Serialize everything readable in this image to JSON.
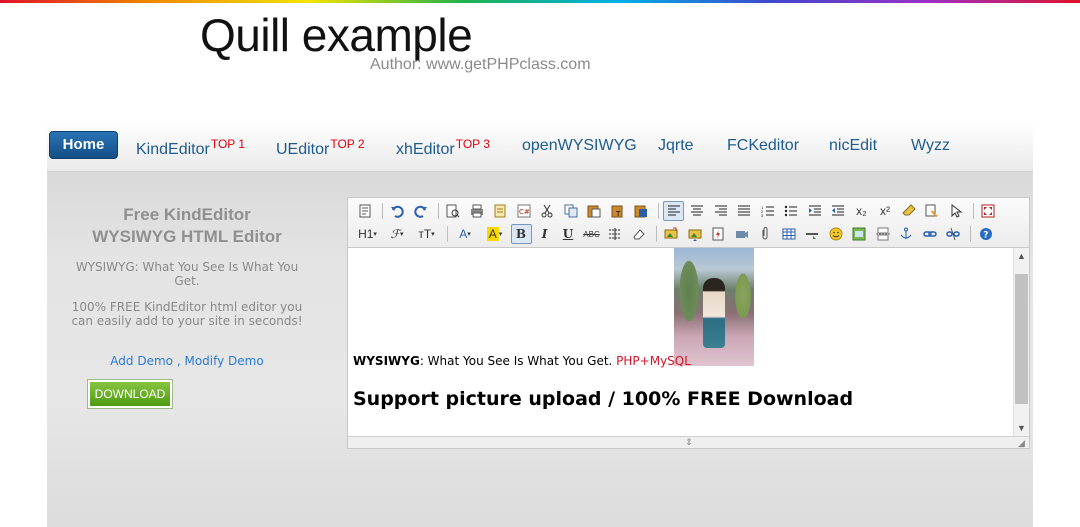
{
  "page": {
    "title": "Quill example",
    "author": "Author: www.getPHPclass.com"
  },
  "nav": {
    "home": "Home",
    "items": [
      {
        "label": "KindEditor",
        "badge": "TOP 1"
      },
      {
        "label": "UEditor",
        "badge": "TOP 2"
      },
      {
        "label": "xhEditor",
        "badge": "TOP 3"
      },
      {
        "label": "openWYSIWYG",
        "badge": ""
      },
      {
        "label": "Jqrte",
        "badge": ""
      },
      {
        "label": "FCKeditor",
        "badge": ""
      },
      {
        "label": "nicEdit",
        "badge": ""
      },
      {
        "label": "Wyzz",
        "badge": ""
      }
    ]
  },
  "promo": {
    "title_line1": "Free KindEditor",
    "title_line2": "WYSIWYG HTML Editor",
    "desc1": "WYSIWYG: What You See Is What You Get.",
    "desc2": "100% FREE KindEditor html editor you can easily add to your site in seconds!",
    "link_add": "Add Demo",
    "link_sep": ",",
    "link_modify": "Modify Demo",
    "download": "DOWNLOAD"
  },
  "editor": {
    "toolbar_text": {
      "heading": "H1",
      "font": "ℱ",
      "size": "ᴛT",
      "fontcolor": "A",
      "highlight": "A",
      "bold": "B",
      "italic": "I",
      "underline": "U",
      "strike": "ABC",
      "clean": "⌐",
      "subscript": "x₂",
      "superscript": "x²",
      "help": "?"
    },
    "content": {
      "line1_bold": "WYSIWYG",
      "line1_text": ": What You See Is What You Get. ",
      "line1_red": "PHP+MySQL",
      "line2": "Support picture upload / 100% FREE Download"
    },
    "accent": "#d0162a"
  }
}
